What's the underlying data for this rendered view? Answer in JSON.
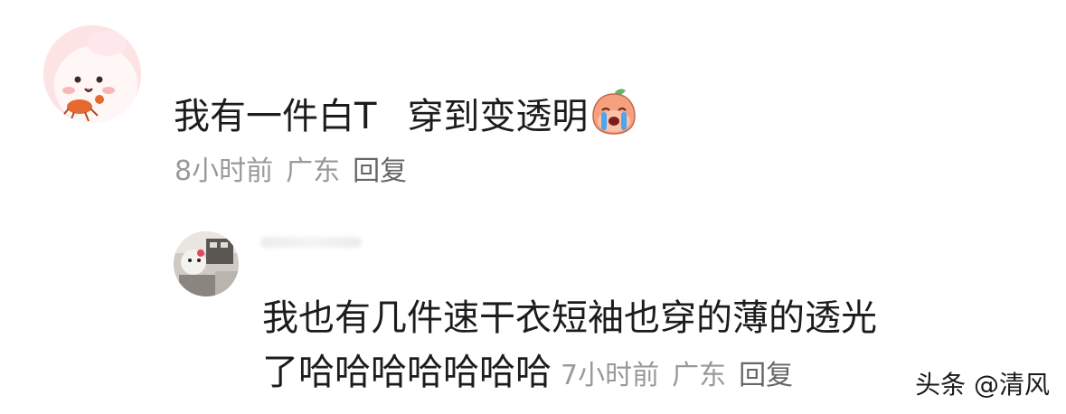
{
  "comment": {
    "text_part1": "我有一件白T",
    "text_part2": "穿到变透明",
    "emoji": "crying-face-emoji",
    "time": "8小时前",
    "location": "广东",
    "reply_label": "回复"
  },
  "reply": {
    "line1": "我也有几件速干衣短袖也穿的薄的透光",
    "line2": "了哈哈哈哈哈哈哈",
    "time": "7小时前",
    "location": "广东",
    "reply_label": "回复"
  },
  "watermark": {
    "text": "头条 @清风"
  },
  "colors": {
    "text": "#1c1c1c",
    "meta": "#999999",
    "avatar_main_bg": "#fde4e4",
    "emoji_peach": "#f6a07e"
  }
}
